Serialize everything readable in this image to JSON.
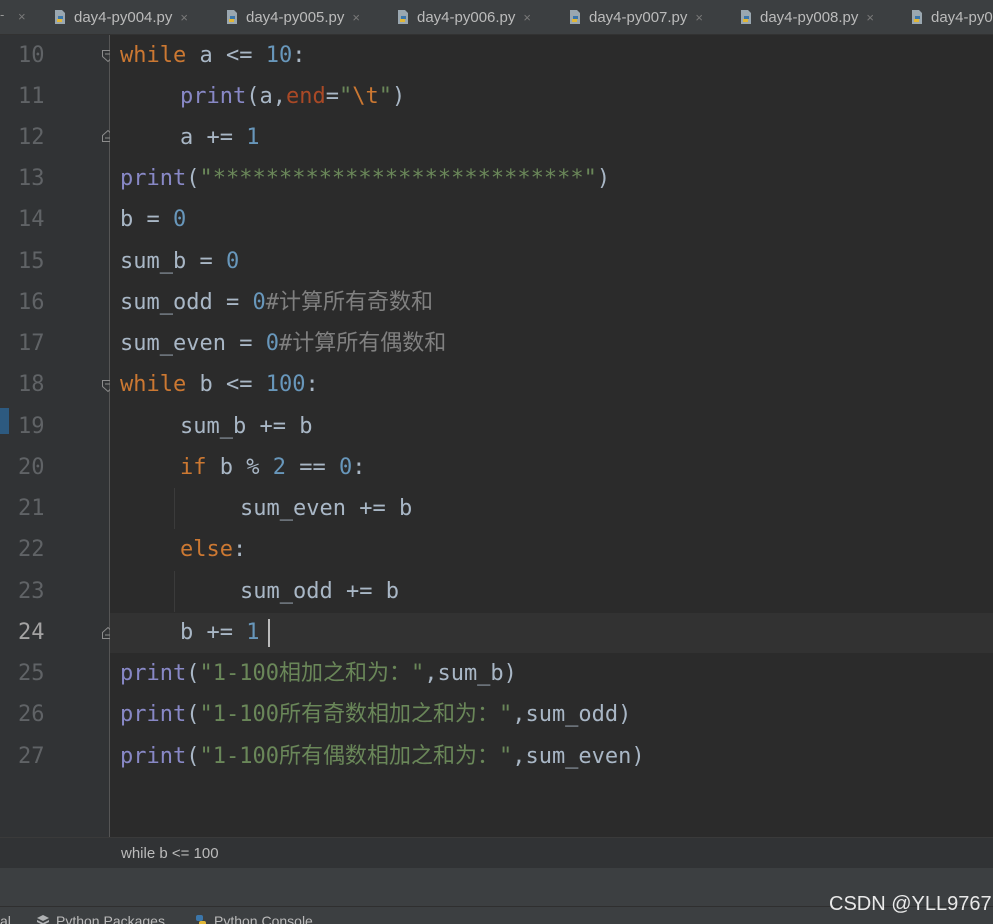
{
  "tabs": [
    {
      "label": "day4-py004.py"
    },
    {
      "label": "day4-py005.py"
    },
    {
      "label": "day4-py006.py"
    },
    {
      "label": "day4-py007.py"
    },
    {
      "label": "day4-py008.py"
    },
    {
      "label": "day4-py0"
    }
  ],
  "tab_close_glyph": "×",
  "line_numbers": [
    "10",
    "11",
    "12",
    "13",
    "14",
    "15",
    "16",
    "17",
    "18",
    "19",
    "20",
    "21",
    "22",
    "23",
    "24",
    "25",
    "26",
    "27"
  ],
  "current_line": "24",
  "code": {
    "l10": {
      "kw": "while",
      "rest": " a <= ",
      "num": "10",
      "end": ":"
    },
    "l11": {
      "fn": "print",
      "open": "(a,",
      "param": "end",
      "eq": "=",
      "q1": "\"",
      "esc": "\\t",
      "q2": "\"",
      "close": ")"
    },
    "l12": {
      "pre": "a += ",
      "num": "1"
    },
    "l13": {
      "fn": "print",
      "open": "(",
      "str": "\"****************************\"",
      "close": ")"
    },
    "l14": {
      "pre": "b = ",
      "num": "0"
    },
    "l15": {
      "pre": "sum_b = ",
      "num": "0"
    },
    "l16": {
      "pre": "sum_odd = ",
      "num": "0",
      "cmt": "#计算所有奇数和"
    },
    "l17": {
      "pre": "sum_even = ",
      "num": "0",
      "cmt": "#计算所有偶数和"
    },
    "l18": {
      "kw": "while",
      "rest": " b <= ",
      "num": "100",
      "end": ":"
    },
    "l19": {
      "text": "sum_b += b"
    },
    "l20": {
      "kw": "if",
      "rest": " b % ",
      "num1": "2",
      "mid": " == ",
      "num2": "0",
      "end": ":"
    },
    "l21": {
      "text": "sum_even += b"
    },
    "l22": {
      "kw": "else",
      "end": ":"
    },
    "l23": {
      "text": "sum_odd += b"
    },
    "l24": {
      "pre": "b += ",
      "num": "1"
    },
    "l25": {
      "fn": "print",
      "open": "(",
      "str": "\"1-100相加之和为：\"",
      "rest": ",sum_b)"
    },
    "l26": {
      "fn": "print",
      "open": "(",
      "str": "\"1-100所有奇数相加之和为：\"",
      "rest": ",sum_odd)"
    },
    "l27": {
      "fn": "print",
      "open": "(",
      "str": "\"1-100所有偶数相加之和为：\"",
      "rest": ",sum_even)"
    }
  },
  "breadcrumb": "while b <= 100",
  "toolwindows": [
    {
      "label": "al"
    },
    {
      "label": "Python Packages"
    },
    {
      "label": "Python Console"
    }
  ],
  "watermark": "CSDN @YLL9767",
  "colors": {
    "keyword": "#cc7832",
    "number": "#6897bb",
    "builtin": "#8888c6",
    "string": "#6a8759",
    "param": "#aa4926",
    "comment": "#808080",
    "text": "#a9b7c6",
    "background": "#2b2b2b"
  }
}
